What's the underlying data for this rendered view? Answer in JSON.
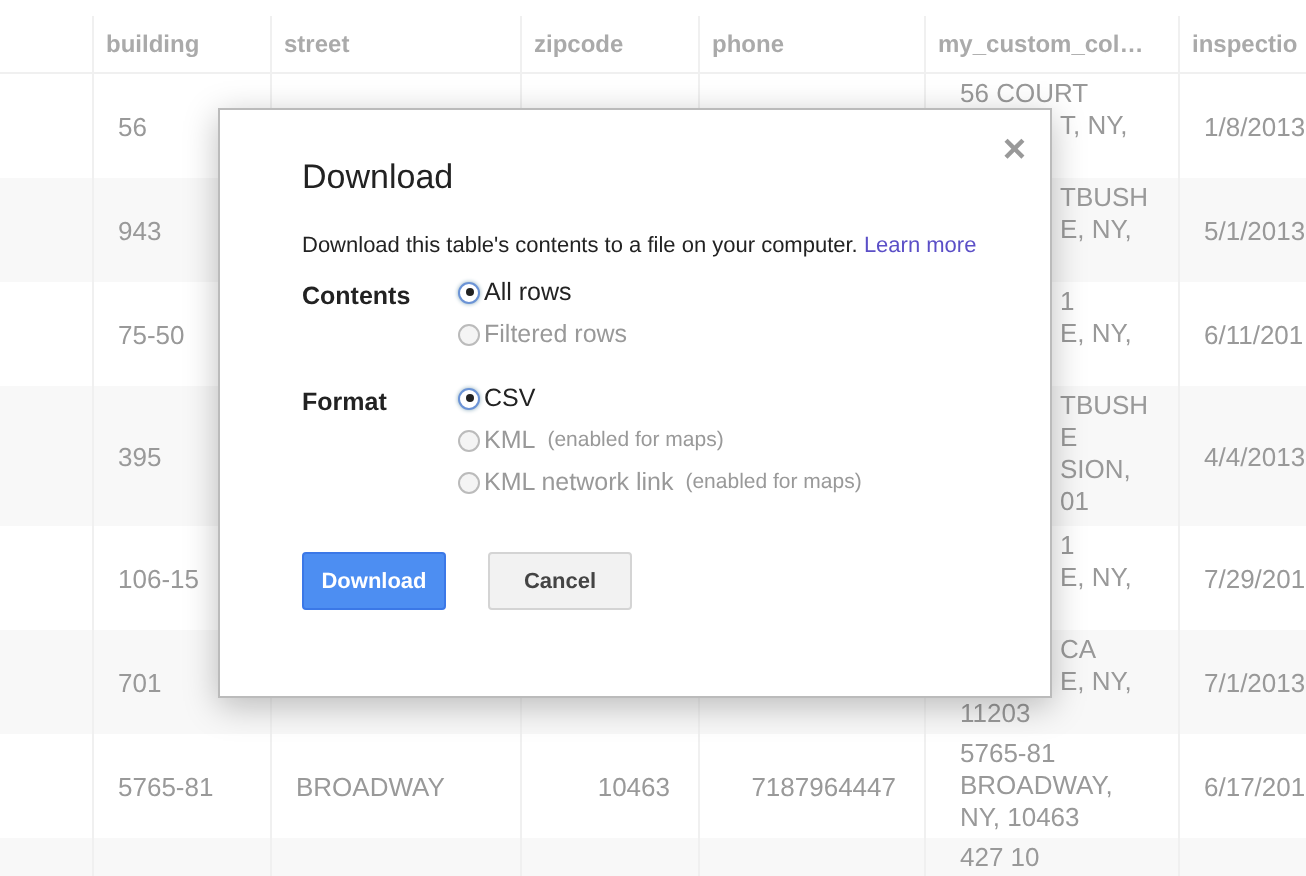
{
  "table": {
    "columns": [
      "building",
      "street",
      "zipcode",
      "phone",
      "my_custom_col…",
      "inspectio"
    ],
    "rows": [
      {
        "building": "56",
        "custom": [
          {
            "text": "56 COURT"
          },
          {
            "text": "T, NY,",
            "cut": true
          }
        ],
        "inspection": "1/8/2013"
      },
      {
        "building": "943",
        "custom": [
          {
            "text": "TBUSH",
            "cut": true
          },
          {
            "text": "E, NY,",
            "cut": true
          }
        ],
        "inspection": "5/1/2013"
      },
      {
        "building": "75-50",
        "custom": [
          {
            "text": "1",
            "cut": true
          },
          {
            "text": "E, NY,",
            "cut": true
          }
        ],
        "inspection": "6/11/201"
      },
      {
        "building": "395",
        "custom": [
          {
            "text": "TBUSH",
            "cut": true
          },
          {
            "text": "E",
            "cut": true
          },
          {
            "text": "SION,",
            "cut": true
          },
          {
            "text": "01",
            "cut": true
          }
        ],
        "inspection": "4/4/2013"
      },
      {
        "building": "106-15",
        "custom": [
          {
            "text": "1",
            "cut": true
          },
          {
            "text": "E, NY,",
            "cut": true
          }
        ],
        "inspection": "7/29/201"
      },
      {
        "building": "701",
        "custom": [
          {
            "text": "CA",
            "cut": true
          },
          {
            "text": "E, NY,",
            "cut": true
          },
          {
            "text": "11203"
          }
        ],
        "inspection": "7/1/2013"
      },
      {
        "building": "5765-81",
        "street": "BROADWAY",
        "zipcode": "10463",
        "phone": "7187964447",
        "custom": [
          {
            "text": "5765-81"
          },
          {
            "text": "BROADWAY,"
          },
          {
            "text": "NY, 10463"
          }
        ],
        "inspection": "6/17/201"
      },
      {
        "custom": [
          {
            "text": "427 10"
          }
        ]
      }
    ]
  },
  "dialog": {
    "title": "Download",
    "close": "×",
    "description": "Download this table's contents to a file on your computer.",
    "learn_more": "Learn more",
    "groups": [
      {
        "label": "Contents",
        "options": [
          {
            "label": "All rows",
            "selected": true,
            "disabled": false
          },
          {
            "label": "Filtered rows",
            "selected": false,
            "disabled": true
          }
        ]
      },
      {
        "label": "Format",
        "options": [
          {
            "label": "CSV",
            "selected": true,
            "disabled": false
          },
          {
            "label": "KML",
            "note": "(enabled for maps)",
            "selected": false,
            "disabled": true
          },
          {
            "label": "KML network link",
            "note": "(enabled for maps)",
            "selected": false,
            "disabled": true
          }
        ]
      }
    ],
    "buttons": [
      {
        "label": "Download",
        "kind": "primary"
      },
      {
        "label": "Cancel",
        "kind": "secondary"
      }
    ]
  }
}
